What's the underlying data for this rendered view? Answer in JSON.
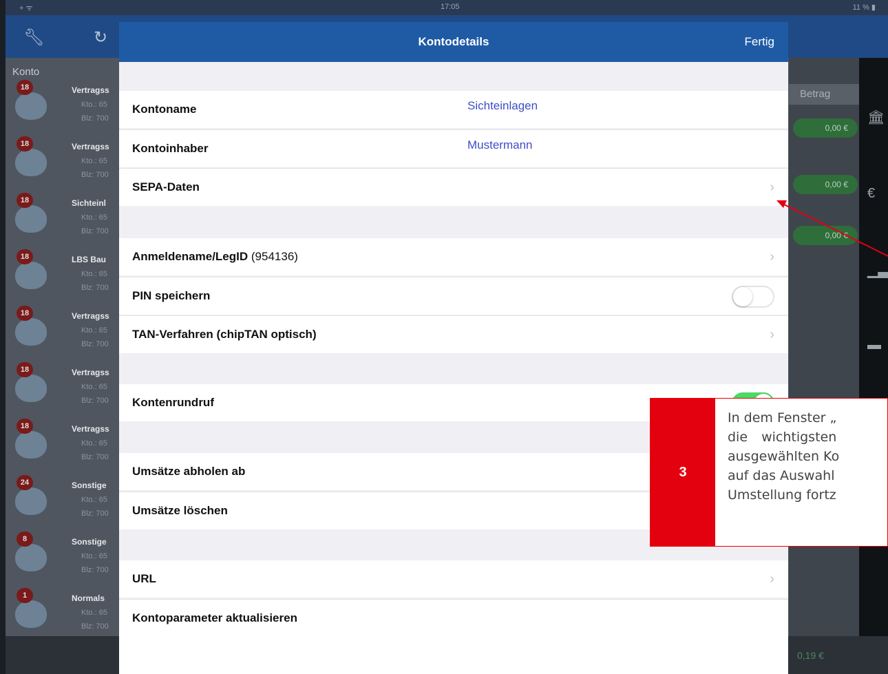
{
  "status": {
    "left": "+ ᯤ",
    "time": "17:05",
    "right": "11 % ▮"
  },
  "app": {
    "konto_header": "Konto",
    "accounts": [
      {
        "badge": "18",
        "name": "Vertragss",
        "sub1": "Kto.: 65",
        "sub2": "Blz: 700"
      },
      {
        "badge": "18",
        "name": "Vertragss",
        "sub1": "Kto.: 65",
        "sub2": "Blz: 700"
      },
      {
        "badge": "18",
        "name": "Sichteinl",
        "sub1": "Kto.: 65",
        "sub2": "Blz: 700"
      },
      {
        "badge": "18",
        "name": "LBS Bau",
        "sub1": "Kto.: 65",
        "sub2": "Blz: 700"
      },
      {
        "badge": "18",
        "name": "Vertragss",
        "sub1": "Kto.: 65",
        "sub2": "Blz: 700"
      },
      {
        "badge": "18",
        "name": "Vertragss",
        "sub1": "Kto.: 65",
        "sub2": "Blz: 700"
      },
      {
        "badge": "18",
        "name": "Vertragss",
        "sub1": "Kto.: 65",
        "sub2": "Blz: 700"
      },
      {
        "badge": "24",
        "name": "Sonstige",
        "sub1": "Kto.: 65",
        "sub2": "Blz: 700"
      },
      {
        "badge": "8",
        "name": "Sonstige",
        "sub1": "Kto.: 65",
        "sub2": "Blz: 700"
      },
      {
        "badge": "1",
        "name": "Normals",
        "sub1": "Kto.: 65",
        "sub2": "Blz: 700"
      }
    ],
    "betrag_header": "Betrag",
    "amounts": [
      "0,00 €",
      "0,00 €",
      "0,00 €"
    ],
    "bottom_value": "0,19 €"
  },
  "modal": {
    "title": "Kontodetails",
    "done": "Fertig",
    "rows": {
      "kontoname": {
        "label": "Kontoname",
        "value": "Sichteinlagen"
      },
      "kontoinhaber": {
        "label": "Kontoinhaber",
        "value": "Mustermann"
      },
      "sepa": {
        "label": "SEPA-Daten"
      },
      "anmeldename": {
        "label": "Anmeldename/LegID",
        "id": "(954136)"
      },
      "pin": {
        "label": "PIN speichern",
        "on": false
      },
      "tan": {
        "label": "TAN-Verfahren (chipTAN optisch)"
      },
      "kontenrundruf": {
        "label": "Kontenrundruf",
        "on": true
      },
      "umsaetze_ab": {
        "label": "Umsätze abholen ab"
      },
      "umsaetze_loeschen": {
        "label": "Umsätze löschen"
      },
      "url": {
        "label": "URL"
      },
      "kontoparameter": {
        "label": "Kontoparameter aktualisieren"
      }
    }
  },
  "callout": {
    "number": "3",
    "lines": [
      "In dem Fenster „",
      "die wichtigsten",
      "ausgewählten Ko",
      "auf das Auswahl",
      "Umstellung fortz"
    ]
  },
  "colors": {
    "callout_red": "#e3000f",
    "nav_blue": "#1f5ba5",
    "link_blue": "#3d4ec6",
    "toggle_green": "#4cd964"
  }
}
